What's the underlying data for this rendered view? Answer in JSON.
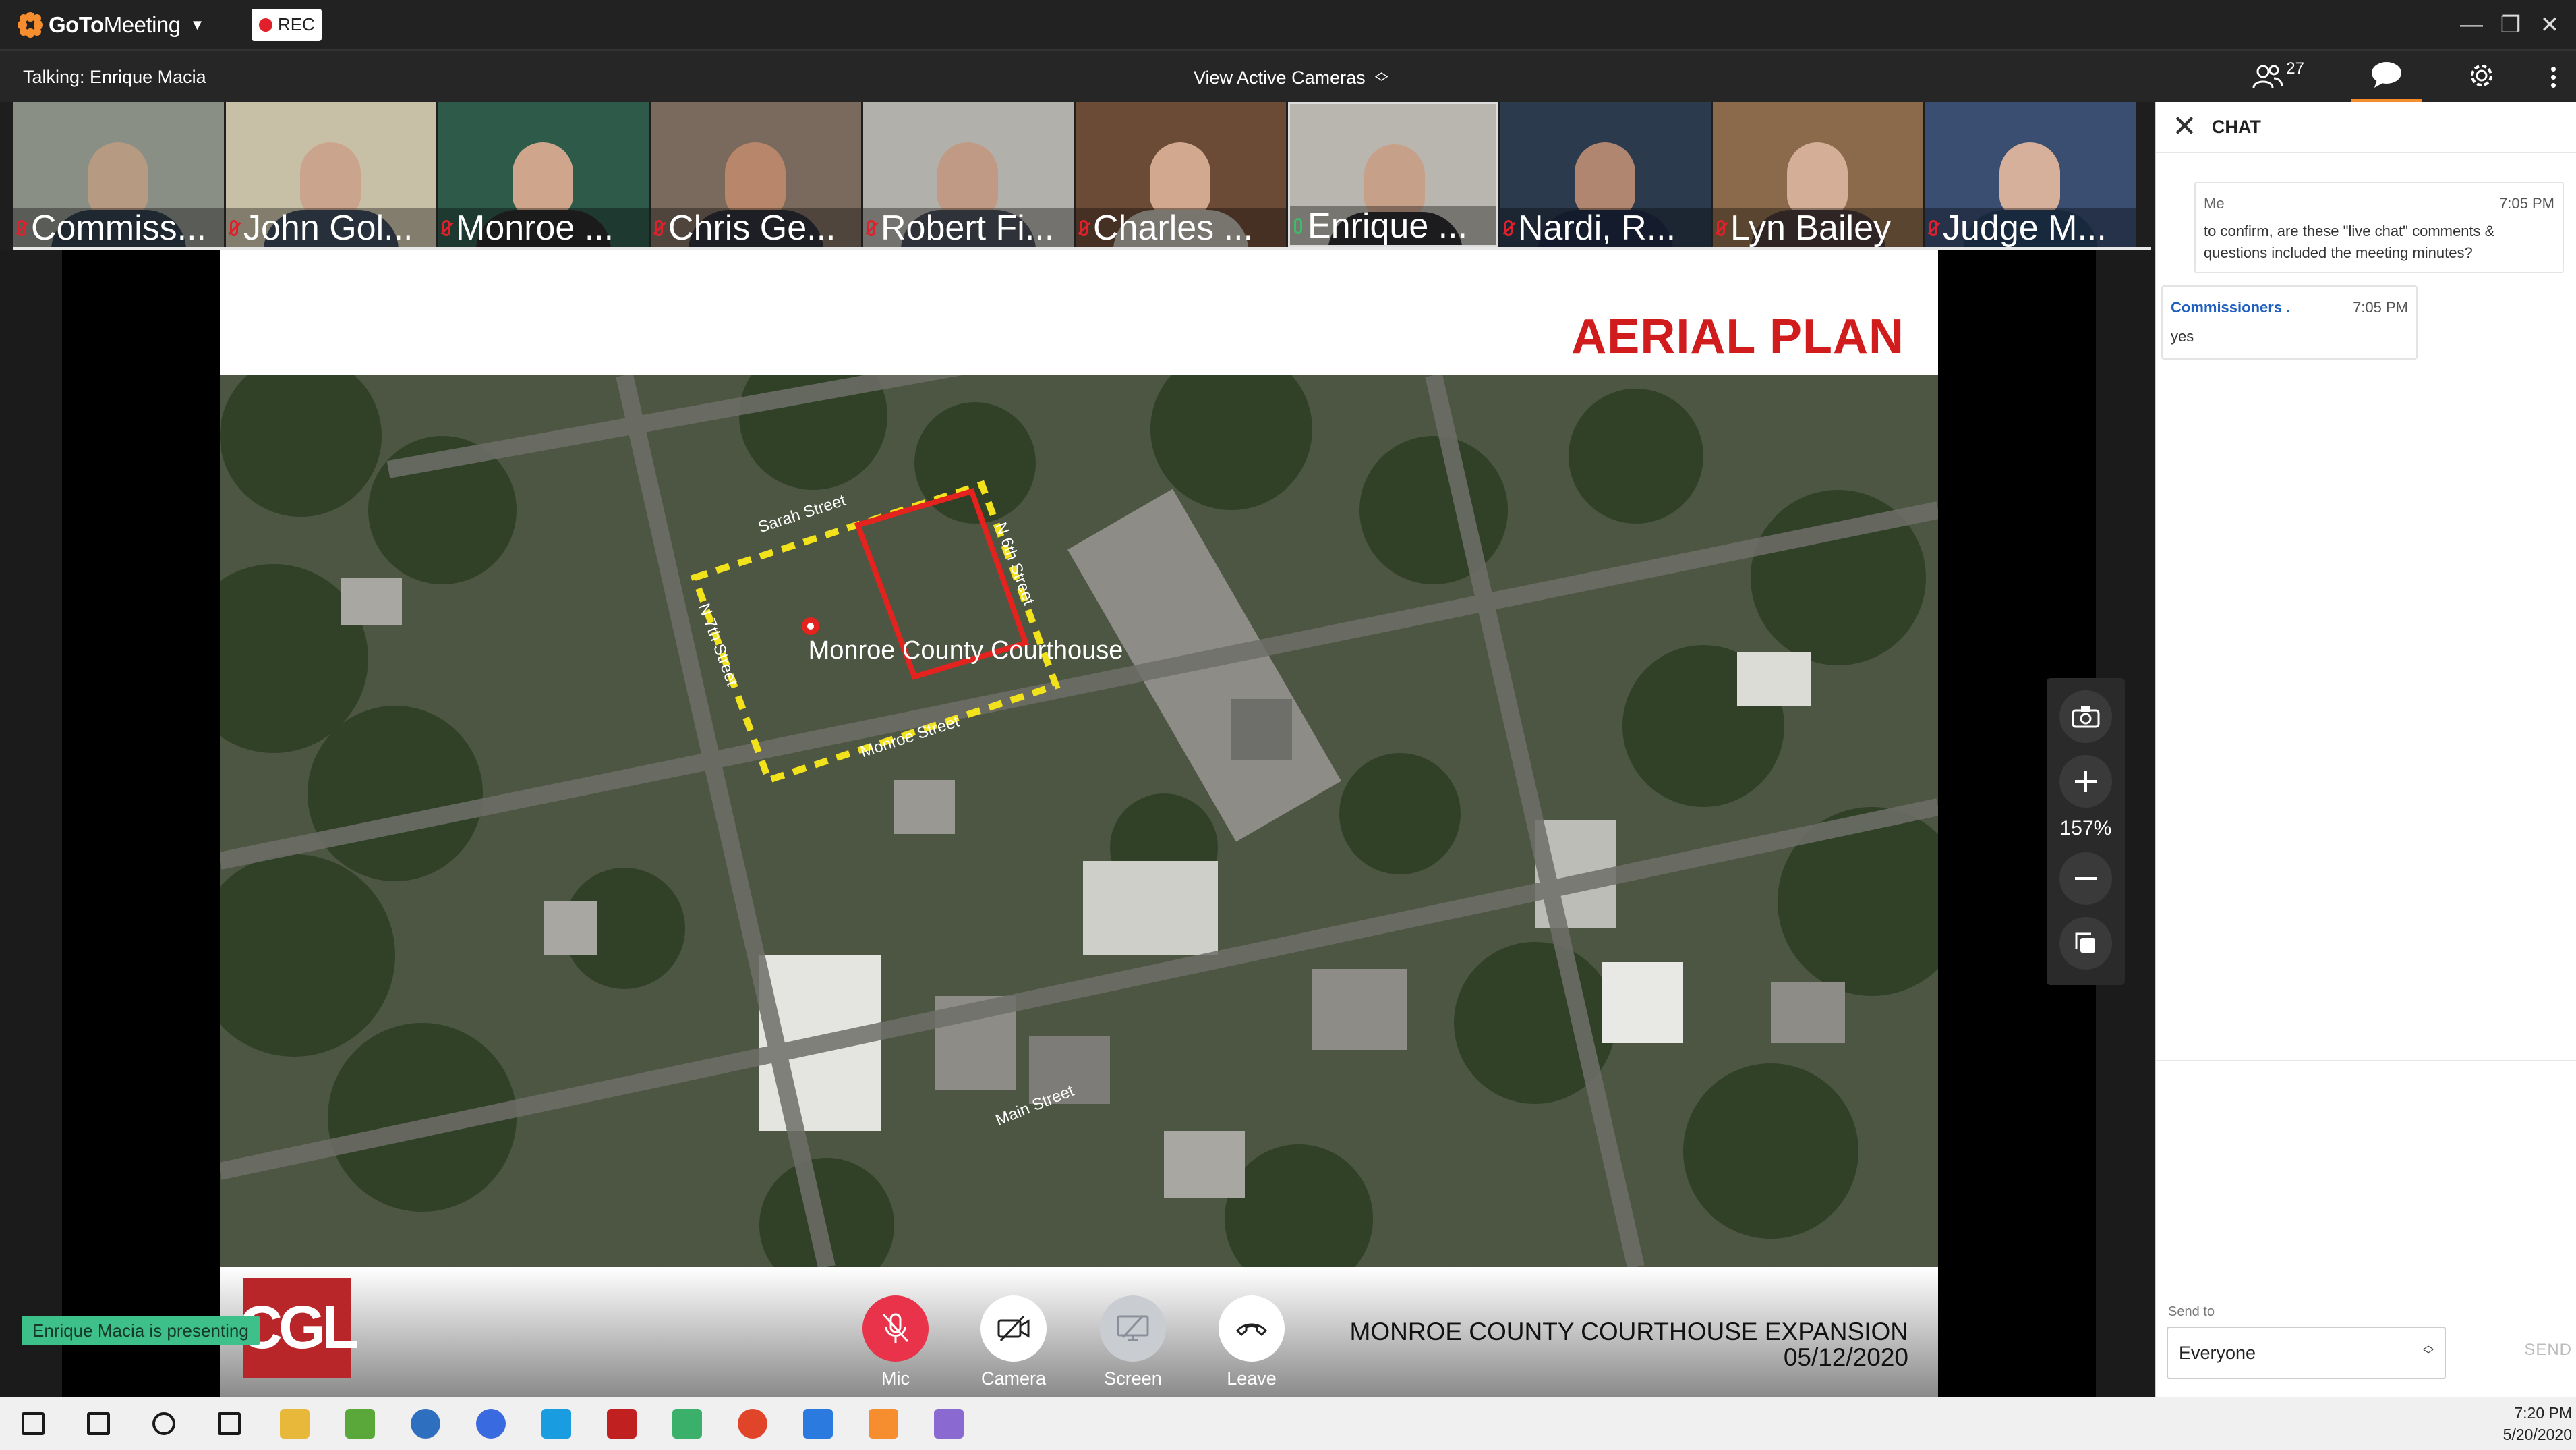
{
  "app": {
    "name_bold": "GoTo",
    "name_light": "Meeting",
    "rec_label": "REC",
    "talking": "Talking: Enrique Macia",
    "view_active_cameras": "View Active Cameras",
    "attendee_count": "27"
  },
  "colors": {
    "brand_orange": "#f68d2e",
    "rec_red": "#e0202a",
    "mic_red": "#e8334a",
    "presenting_green": "#3ec08a",
    "slide_title_red": "#d01c1c",
    "chat_sender_blue": "#1f5fbf"
  },
  "cameras": [
    {
      "name": "Commiss...",
      "mic": "muted",
      "bg": "#8a8f86",
      "skin": "#b79a82",
      "shirt": "#303d4a"
    },
    {
      "name": "John Gol...",
      "mic": "muted",
      "bg": "#c8c0a6",
      "skin": "#caa48c",
      "shirt": "#3c4a5a"
    },
    {
      "name": "Monroe ...",
      "mic": "muted",
      "bg": "#2e5a4a",
      "skin": "#cfa68b",
      "shirt": "#2a2a2a"
    },
    {
      "name": "Chris Ge...",
      "mic": "muted",
      "bg": "#7a6a5e",
      "skin": "#b8866a",
      "shirt": "#2f2f3a"
    },
    {
      "name": "Robert Fi...",
      "mic": "muted",
      "bg": "#b2b0aa",
      "skin": "#c09a84",
      "shirt": "#4a4d58"
    },
    {
      "name": "Charles ...",
      "mic": "muted",
      "bg": "#6b4a36",
      "skin": "#d2a88e",
      "shirt": "#b8b4aa"
    },
    {
      "name": "Enrique ...",
      "mic": "on",
      "bg": "#b8b6ae",
      "skin": "#c7a08a",
      "shirt": "#2b2b2e"
    },
    {
      "name": "Nardi, R...",
      "mic": "muted",
      "bg": "#2c3a4e",
      "skin": "#b08670",
      "shirt": "#1f2a44"
    },
    {
      "name": "Lyn Bailey",
      "mic": "muted",
      "bg": "#8a6a4a",
      "skin": "#d4ae96",
      "shirt": "#4a3a3a"
    },
    {
      "name": "Judge M...",
      "mic": "muted",
      "bg": "#3a4e72",
      "skin": "#d6b09a",
      "shirt": "#27405e"
    }
  ],
  "slide": {
    "title": "AERIAL PLAN",
    "logo_text": "CGL",
    "footer_line1": "MONROE COUNTY COURTHOUSE EXPANSION",
    "footer_line2": "05/12/2020",
    "map_labels": {
      "courthouse": "Monroe County Courthouse",
      "sarah_street": "Sarah Street",
      "n6th_street": "N 6th Street",
      "n7th_street": "N 7th Street",
      "monroe_street": "Monroe Street",
      "main_street": "Main Street"
    }
  },
  "zoom": {
    "percent": "157%"
  },
  "presenting_banner": "Enrique Macia is presenting",
  "controls": {
    "mic": "Mic",
    "camera": "Camera",
    "screen": "Screen",
    "leave": "Leave"
  },
  "chat": {
    "title": "CHAT",
    "messages": [
      {
        "sender": "Me",
        "time": "7:05 PM",
        "text": "to confirm, are these \"live chat\" comments & questions included the meeting minutes?"
      },
      {
        "sender": "Commissioners .",
        "time": "7:05 PM",
        "text": "yes"
      }
    ],
    "send_to_label": "Send to",
    "send_to_value": "Everyone",
    "send_button": "SEND"
  },
  "taskbar": {
    "icons": [
      "windows-start-icon",
      "search-icon",
      "cortana-icon",
      "task-view-icon",
      "file-explorer-icon",
      "notepad-icon",
      "browser-icon",
      "signal-icon",
      "skype-icon",
      "filezilla-icon",
      "pen-icon",
      "chrome-icon",
      "app-icon",
      "gotomeeting-icon",
      "paint-icon"
    ],
    "time": "7:20 PM",
    "date": "5/20/2020"
  }
}
